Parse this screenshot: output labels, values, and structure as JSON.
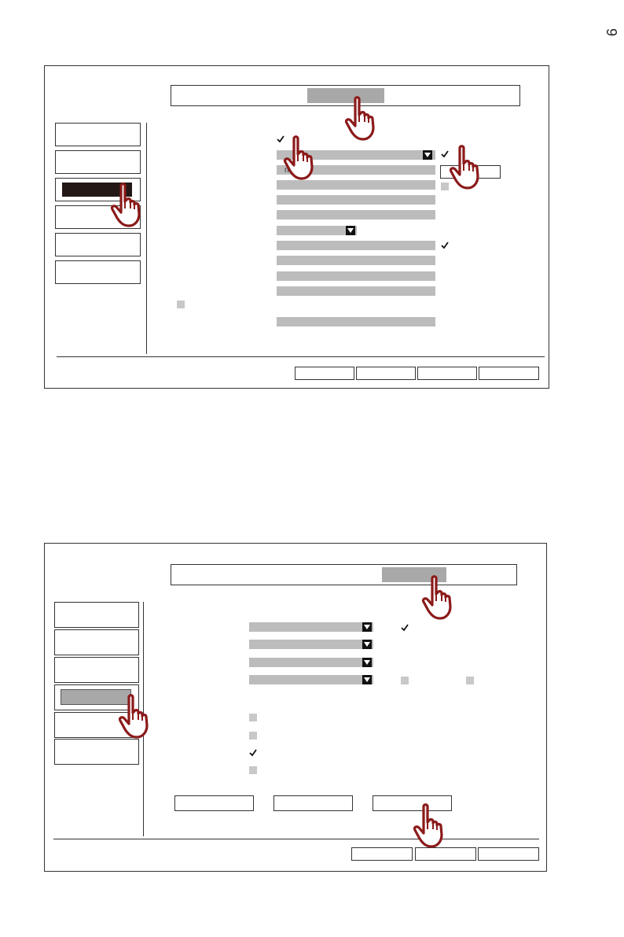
{
  "page": {
    "number": "9"
  },
  "panel1": {
    "field_hint": "no",
    "preset_box": ""
  },
  "panel2": {},
  "icons": {
    "pointer": "hand-pointer-icon",
    "check": "checkmark-icon",
    "dropdown": "triangle-down-icon"
  },
  "colors": {
    "cursor_fill": "#ffffff",
    "cursor_outline": "#8b1a1a",
    "active": "#a8a8a8",
    "dark_selected": "#231816",
    "field": "#bcbcbc"
  }
}
